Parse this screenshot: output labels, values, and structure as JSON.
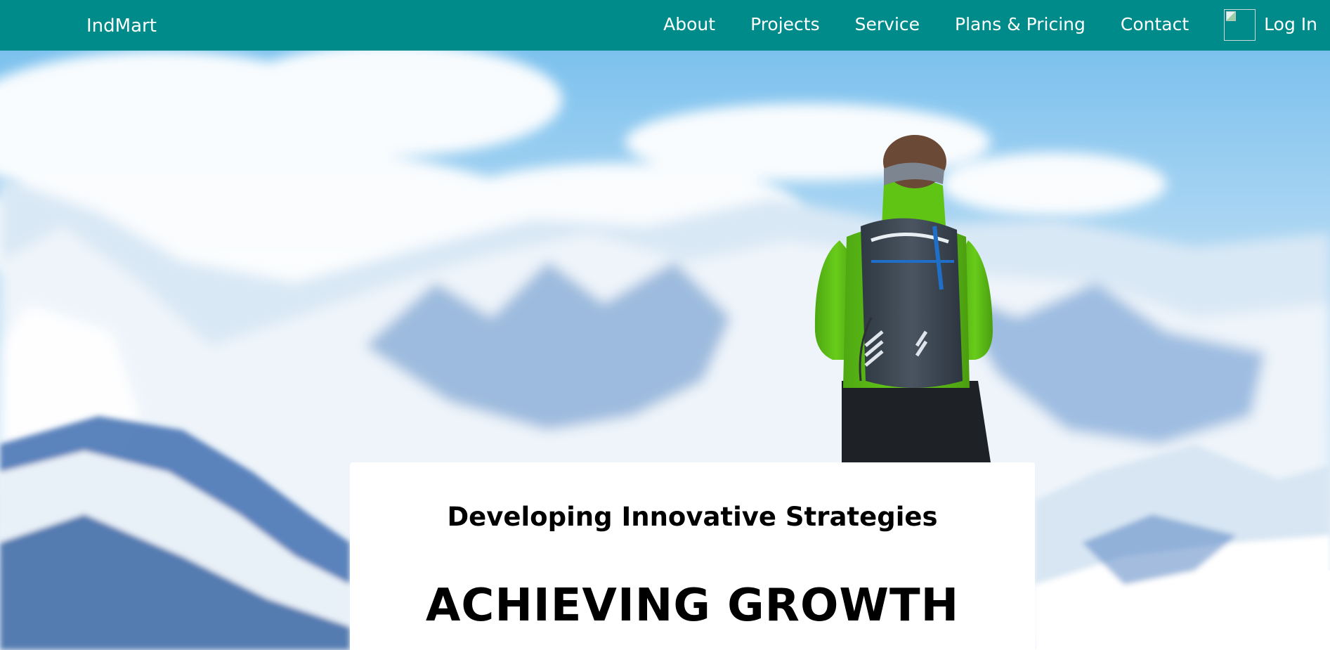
{
  "navbar": {
    "brand": "IndMart",
    "links": [
      {
        "label": "About"
      },
      {
        "label": "Projects"
      },
      {
        "label": "Service"
      },
      {
        "label": "Plans & Pricing"
      },
      {
        "label": "Contact"
      }
    ],
    "login_label": "Log In",
    "login_icon": "broken-image-icon"
  },
  "hero": {
    "subtitle": "Developing Innovative Strategies",
    "title": "ACHIEVING GROWTH"
  },
  "colors": {
    "navbar_bg": "#008b8b",
    "nav_text": "#ffffff",
    "card_bg": "#ffffff",
    "card_text": "#000000",
    "jacket": "#5dc014",
    "backpack": "#3c4652",
    "sky": "#7fc3ee"
  }
}
